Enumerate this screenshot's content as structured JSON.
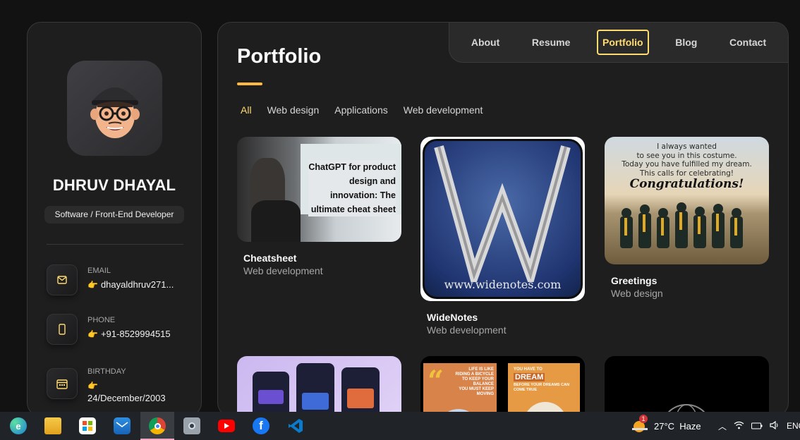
{
  "profile": {
    "name": "DHRUV DHAYAL",
    "role": "Software / Front-End Developer",
    "contacts": [
      {
        "title": "Email",
        "value": "dhayaldhruv271...",
        "icon": "mail-icon"
      },
      {
        "title": "Phone",
        "value": "+91-8529994515",
        "icon": "phone-icon"
      },
      {
        "title": "Birthday",
        "value": "24/December/2003",
        "icon": "calendar-icon"
      }
    ]
  },
  "nav": {
    "items": [
      "About",
      "Resume",
      "Portfolio",
      "Blog",
      "Contact"
    ],
    "active": "Portfolio"
  },
  "page": {
    "title": "Portfolio",
    "filters": [
      "All",
      "Web design",
      "Applications",
      "Web development"
    ],
    "active_filter": "All"
  },
  "projects": [
    {
      "title": "Cheatsheet",
      "category": "Web development",
      "thumb_text": [
        "ChatGPT for product",
        "design and",
        "innovation: The",
        "ultimate cheat sheet"
      ]
    },
    {
      "title": "WideNotes",
      "category": "Web development",
      "thumb_text": "www.widenotes.com"
    },
    {
      "title": "Greetings",
      "category": "Web design",
      "thumb_text": [
        "I always wanted",
        "to see you in this costume.",
        "Today you have fulfilled my dream.",
        "This calls for celebrating!",
        "Congratulations!"
      ]
    },
    {
      "title": "",
      "category": ""
    },
    {
      "title": "",
      "category": "",
      "thumb_text": [
        "LIFE IS LIKE",
        "RIDING A BICYCLE",
        "TO KEEP YOUR",
        "BALANCE",
        "YOU MUST KEEP",
        "MOVING",
        "YOU HAVE TO",
        "DREAM",
        "BEFORE YOUR DREAMS CAN",
        "COME TRUE"
      ]
    },
    {
      "title": "",
      "category": ""
    }
  ],
  "taskbar": {
    "weather": "27°C  Haze",
    "badge": "1",
    "lang": "ENG",
    "apps": [
      "edge-icon",
      "file-explorer-icon",
      "store-icon",
      "mail-app-icon",
      "chrome-icon",
      "camera-icon",
      "youtube-icon",
      "facebook-icon",
      "vscode-icon"
    ]
  },
  "colors": {
    "accent": "#ffdb70",
    "bar": "#ffb93f",
    "card": "#1e1e1f",
    "bg": "#121212"
  }
}
